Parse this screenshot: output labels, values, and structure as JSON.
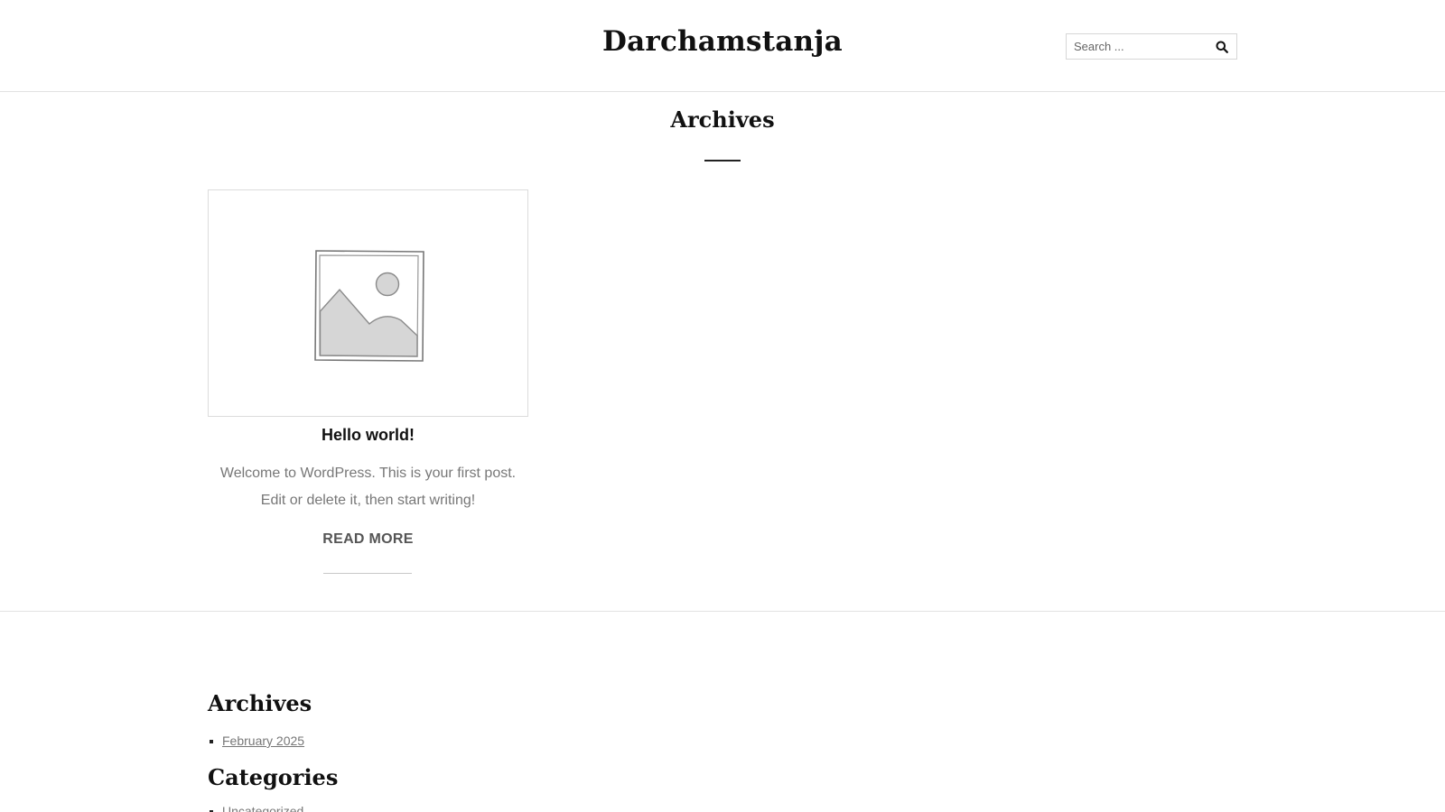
{
  "header": {
    "site_title": "Darchamstanja",
    "search": {
      "placeholder": "Search ...",
      "value": ""
    }
  },
  "page": {
    "title": "Archives"
  },
  "posts": [
    {
      "title": "Hello world!",
      "excerpt": "Welcome to WordPress. This is your first post. Edit or delete it, then start writing!",
      "read_more_label": "READ MORE",
      "thumbnail_icon": "image-placeholder-icon"
    }
  ],
  "footer": {
    "widgets": [
      {
        "title": "Archives",
        "items": [
          "February 2025"
        ]
      },
      {
        "title": "Categories",
        "items": [
          "Uncategorized"
        ]
      }
    ]
  },
  "colors": {
    "text": "#111111",
    "muted_text": "#777777",
    "border": "#e2e2e2"
  }
}
